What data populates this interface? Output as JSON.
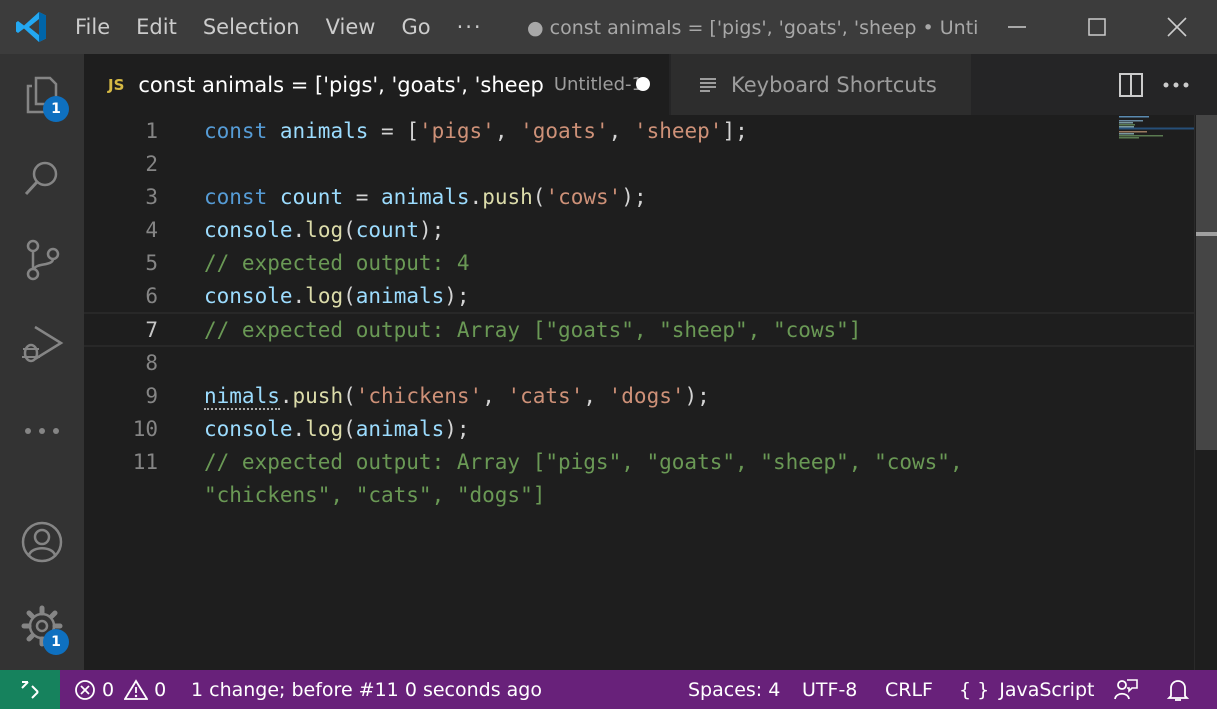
{
  "menu": [
    "File",
    "Edit",
    "Selection",
    "View",
    "Go",
    "···"
  ],
  "window_title": "● const animals = ['pigs', 'goats', 'sheep • Untit...",
  "activity": {
    "explorer_badge": "1",
    "settings_badge": "1"
  },
  "tabs": {
    "active": {
      "icon": "JS",
      "title": "const animals = ['pigs', 'goats', 'sheep",
      "description": "Untitled-1"
    },
    "inactive": {
      "title": "Keyboard Shortcuts"
    }
  },
  "editor": {
    "line_numbers": [
      "1",
      "2",
      "3",
      "4",
      "5",
      "6",
      "7",
      "8",
      "9",
      "10",
      "11"
    ],
    "current_line": "7",
    "lines": [
      "const animals = ['pigs', 'goats', 'sheep'];",
      "",
      "const count = animals.push('cows');",
      "console.log(count);",
      "// expected output: 4",
      "console.log(animals);",
      "// expected output: Array [\"goats\", \"sheep\", \"cows\"]",
      "",
      "nimals.push('chickens', 'cats', 'dogs');",
      "console.log(animals);",
      "// expected output: Array [\"pigs\", \"goats\", \"sheep\", \"cows\",",
      "\"chickens\", \"cats\", \"dogs\"]"
    ]
  },
  "status": {
    "errors": "0",
    "warnings": "0",
    "change_info": "1 change; before #11  0 seconds ago",
    "spaces": "Spaces: 4",
    "encoding": "UTF-8",
    "eol": "CRLF",
    "language_icon": "{ }",
    "language": "JavaScript"
  },
  "colors": {
    "statusbar": "#68217a",
    "remote": "#16825d",
    "badge": "#0e70c0",
    "keyword": "#569cd6",
    "string": "#ce9178",
    "comment": "#6a9955",
    "function": "#dcdcaa",
    "variable": "#9cdcfe"
  }
}
